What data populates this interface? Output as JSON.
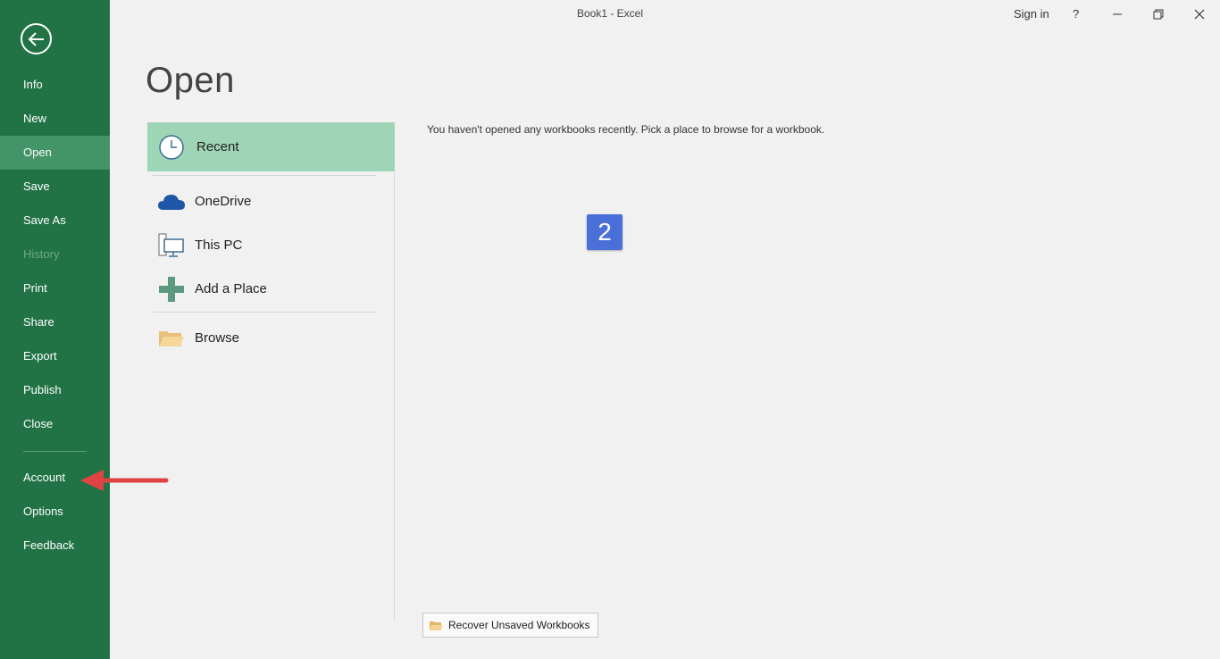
{
  "window": {
    "title": "Book1 - Excel",
    "sign_in": "Sign in",
    "help": "?"
  },
  "nav": {
    "items": [
      {
        "label": "Info"
      },
      {
        "label": "New"
      },
      {
        "label": "Open"
      },
      {
        "label": "Save"
      },
      {
        "label": "Save As"
      },
      {
        "label": "History"
      },
      {
        "label": "Print"
      },
      {
        "label": "Share"
      },
      {
        "label": "Export"
      },
      {
        "label": "Publish"
      },
      {
        "label": "Close"
      },
      {
        "label": "Account"
      },
      {
        "label": "Options"
      },
      {
        "label": "Feedback"
      }
    ],
    "active": "Open",
    "disabled": "History"
  },
  "main": {
    "title": "Open",
    "places": [
      {
        "label": "Recent",
        "icon": "clock-icon"
      },
      {
        "label": "OneDrive",
        "icon": "onedrive-cloud-icon"
      },
      {
        "label": "This PC",
        "icon": "computer-icon"
      },
      {
        "label": "Add a Place",
        "icon": "plus-icon"
      },
      {
        "label": "Browse",
        "icon": "folder-icon"
      }
    ],
    "empty_message": "You haven't opened any workbooks recently. Pick a place to browse for a workbook.",
    "recover_button": "Recover Unsaved Workbooks"
  },
  "annotation": {
    "badge_number": "2",
    "badge_color": "#4a6fd8",
    "arrow_color": "#e04343"
  },
  "colors": {
    "nav_bg": "#217346",
    "nav_active": "#439467",
    "recent_active": "#9fd5b7"
  }
}
